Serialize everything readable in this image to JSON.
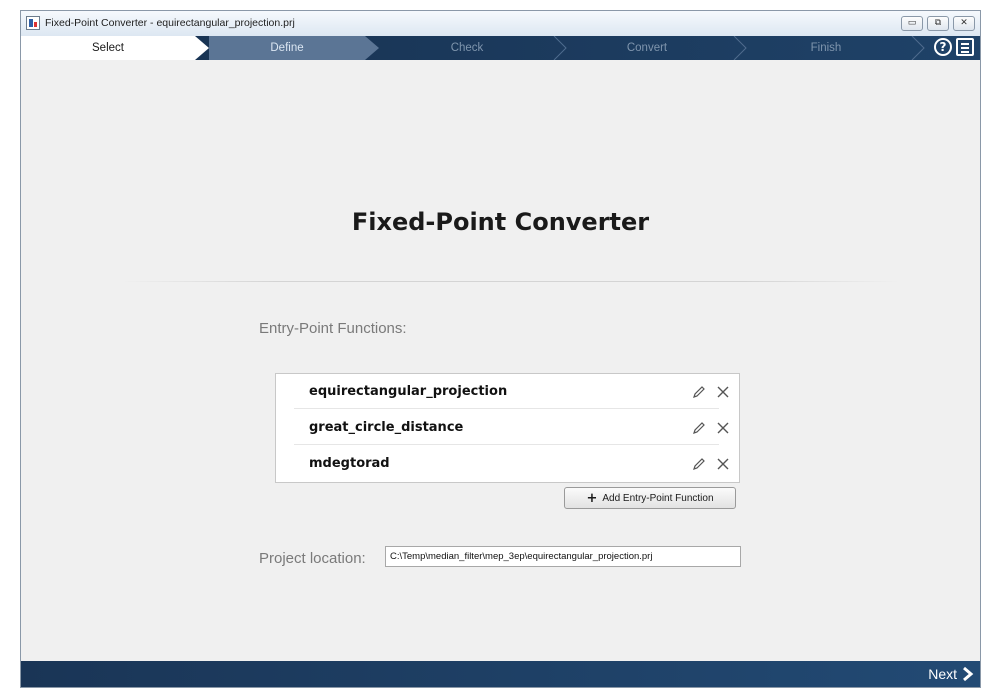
{
  "window": {
    "title": "Fixed-Point Converter - equirectangular_projection.prj",
    "controls": {
      "minimize": "▭",
      "restore": "⧉",
      "close": "✕"
    }
  },
  "workflow": {
    "steps": [
      {
        "label": "Select",
        "state": "active"
      },
      {
        "label": "Define",
        "state": "next"
      },
      {
        "label": "Check",
        "state": "pending"
      },
      {
        "label": "Convert",
        "state": "pending"
      },
      {
        "label": "Finish",
        "state": "pending"
      }
    ],
    "help_glyph": "?"
  },
  "main": {
    "title": "Fixed-Point Converter",
    "entry_points_label": "Entry-Point Functions:",
    "entry_points": [
      {
        "name": "equirectangular_projection"
      },
      {
        "name": "great_circle_distance"
      },
      {
        "name": "mdegtorad"
      }
    ],
    "add_button_label": "Add Entry-Point Function",
    "add_button_glyph": "+",
    "project_location_label": "Project location:",
    "project_location_value": "C:\\Temp\\median_filter\\mep_3ep\\equirectangular_projection.prj"
  },
  "footer": {
    "next_label": "Next"
  },
  "colors": {
    "workflow_bg": "#17304f",
    "active_step": "#ffffff",
    "next_step": "#5b7595",
    "background": "#f0f0f0"
  },
  "icons": {
    "app": "app-icon",
    "help": "help-icon",
    "menu": "menu-icon",
    "edit": "pencil-icon",
    "remove": "close-icon",
    "next": "chevron-right-icon"
  }
}
